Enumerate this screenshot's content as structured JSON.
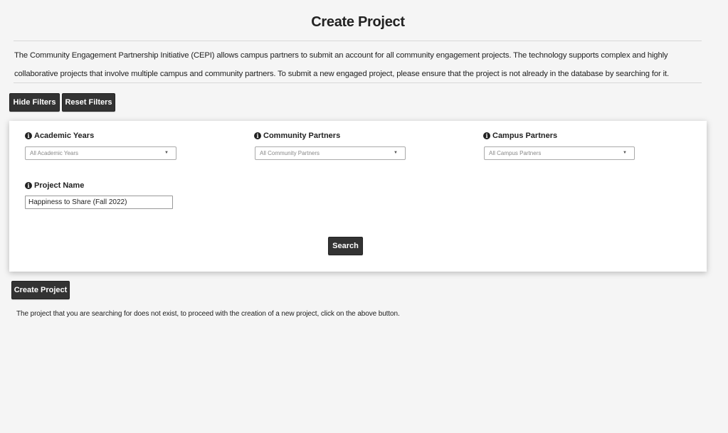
{
  "page": {
    "title": "Create Project",
    "intro": "The Community Engagement Partnership Initiative (CEPI) allows campus partners to submit an account for all community engagement projects. The technology supports complex and highly collaborative projects that involve multiple campus and community partners. To submit a new engaged project, please ensure that the project is not already in the database by searching for it."
  },
  "toolbar": {
    "hide_filters": "Hide Filters",
    "reset_filters": "Reset Filters"
  },
  "filters": {
    "academic_years": {
      "label": "Academic Years",
      "value": "All Academic Years"
    },
    "community_partners": {
      "label": "Community Partners",
      "value": "All Community Partners"
    },
    "campus_partners": {
      "label": "Campus Partners",
      "value": "All Campus Partners"
    },
    "project_name": {
      "label": "Project Name",
      "value": "Happiness to Share (Fall 2022)"
    },
    "search_label": "Search"
  },
  "actions": {
    "create_project": "Create Project"
  },
  "message": "The project that you are searching for does not exist, to proceed with the creation of a new project, click on the above button."
}
